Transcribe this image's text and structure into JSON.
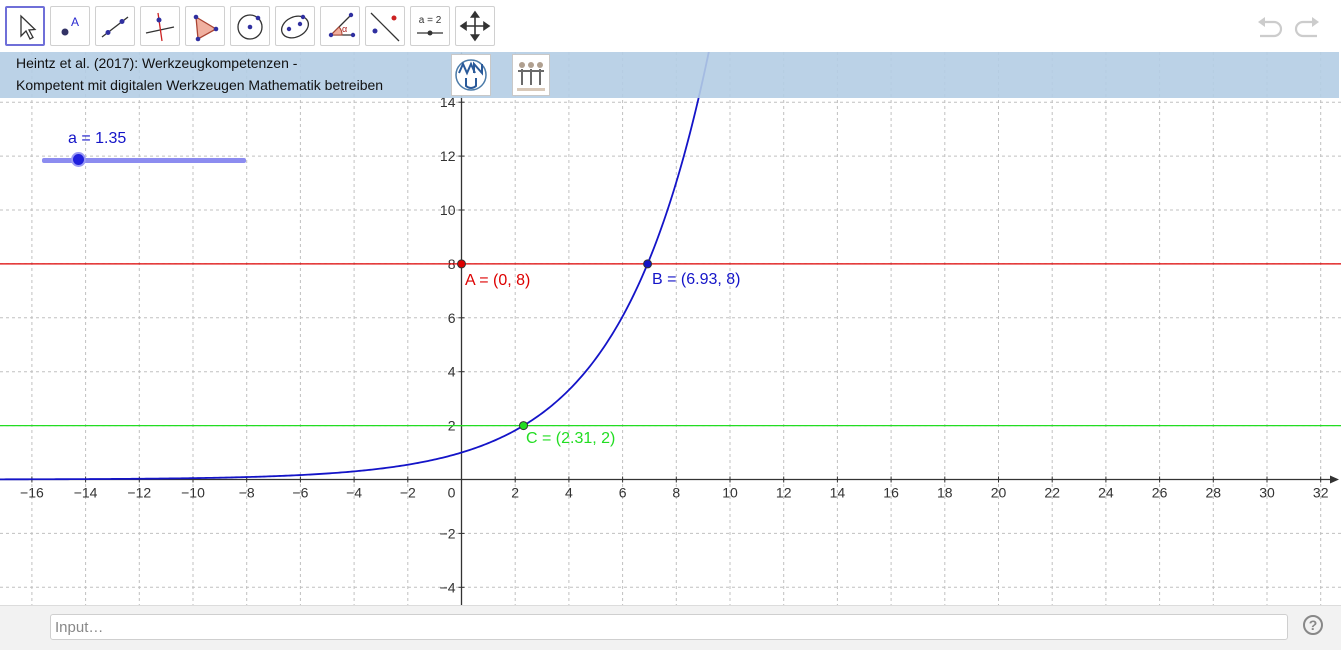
{
  "toolbar": {
    "tools": [
      {
        "name": "move-tool",
        "icon": "arrow-cursor-icon"
      },
      {
        "name": "point-tool",
        "icon": "point-icon",
        "glyph": "A"
      },
      {
        "name": "line-tool",
        "icon": "line-through-points-icon"
      },
      {
        "name": "perpendicular-line-tool",
        "icon": "perpendicular-line-icon"
      },
      {
        "name": "polygon-tool",
        "icon": "polygon-icon"
      },
      {
        "name": "circle-tool",
        "icon": "circle-center-point-icon"
      },
      {
        "name": "conic-tool",
        "icon": "ellipse-icon"
      },
      {
        "name": "angle-tool",
        "icon": "angle-icon",
        "glyph": "α"
      },
      {
        "name": "reflect-tool",
        "icon": "reflect-about-line-icon"
      },
      {
        "name": "slider-tool",
        "icon": "slider-icon",
        "glyph": "a = 2"
      },
      {
        "name": "move-graphics-view-tool",
        "icon": "move-graphics-view-icon"
      }
    ],
    "selected_index": 0,
    "undo_icon": "undo-icon",
    "redo_icon": "redo-icon"
  },
  "info": {
    "line1": "Heintz et al. (2017): Werkzeugkompetenzen -",
    "line2": "Kompetent mit digitalen Werkzeugen Mathematik betreiben",
    "logos": [
      "mnu-logo",
      "t3-logo"
    ]
  },
  "slider": {
    "label": "a = 1.35",
    "value": 1.35,
    "min": -5,
    "max": 5
  },
  "graph": {
    "x_ticks": [
      -16,
      -14,
      -12,
      -10,
      -8,
      -6,
      -4,
      -2,
      0,
      2,
      4,
      6,
      8,
      10,
      12,
      14,
      16,
      18,
      20,
      22,
      24,
      26,
      28,
      30,
      32
    ],
    "x_tick_labels": [
      "−16",
      "−14",
      "−12",
      "−10",
      "−8",
      "−6",
      "−4",
      "−2",
      "0",
      "2",
      "4",
      "6",
      "8",
      "10",
      "12",
      "14",
      "16",
      "18",
      "20",
      "22",
      "24",
      "26",
      "28",
      "30",
      "32"
    ],
    "y_ticks": [
      -4,
      -2,
      2,
      4,
      6,
      8,
      10,
      12,
      14
    ],
    "y_tick_labels": [
      "−4",
      "−2",
      "2",
      "4",
      "6",
      "8",
      "10",
      "12",
      "14"
    ],
    "x_range": [
      -17,
      32.5
    ],
    "y_range": [
      -4.5,
      16.5
    ],
    "grid": true,
    "function": {
      "base": 1.35
    },
    "lines": [
      {
        "y": 8,
        "color": "#dd0000"
      },
      {
        "y": 2,
        "color": "#22dd22"
      }
    ],
    "points": {
      "A": {
        "label": "A = (0, 8)",
        "x": 0,
        "y": 8,
        "color": "#dd0000"
      },
      "B": {
        "label": "B = (6.93, 8)",
        "x": 6.93,
        "y": 8,
        "color": "#1414c8"
      },
      "C": {
        "label": "C = (2.31, 2)",
        "x": 2.31,
        "y": 2,
        "color": "#22dd22"
      }
    },
    "curve_color": "#1414c8"
  },
  "input": {
    "placeholder": "Input…"
  },
  "help": {
    "label": "?"
  }
}
